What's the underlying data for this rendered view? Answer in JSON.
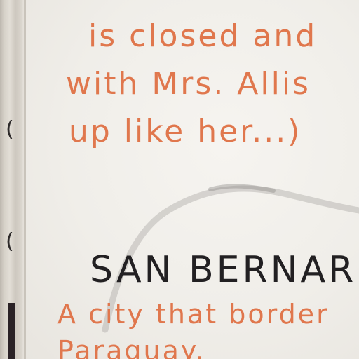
{
  "note": {
    "line1": "is closed and",
    "line2": "with Mrs. Allis",
    "line3": "up like her...)",
    "heading": "SAN BERNAR",
    "definition_line1": "A city that border",
    "definition_line2": "Paraguay."
  },
  "margin_marks": {
    "bracket_top": "(",
    "bracket_bottom": "("
  },
  "colors": {
    "ink_orange": "#e0774d",
    "ink_black": "#222022",
    "paper": "#f0eee9",
    "pencil_smudge": "#9a9894"
  }
}
